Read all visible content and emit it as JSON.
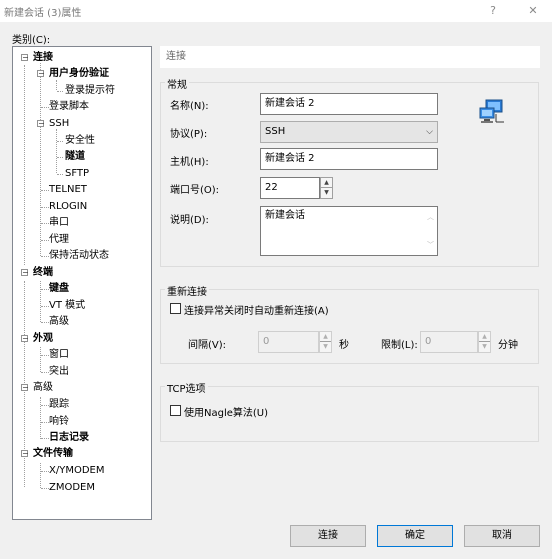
{
  "window": {
    "title": "新建会话 (3)属性",
    "help": "?",
    "close": "✕"
  },
  "category_label": "类别(C):",
  "tree": {
    "items": [
      {
        "label": "连接",
        "bold": true
      },
      {
        "label": "用户身份验证",
        "bold": true
      },
      {
        "label": "登录提示符"
      },
      {
        "label": "登录脚本"
      },
      {
        "label": "SSH"
      },
      {
        "label": "安全性"
      },
      {
        "label": "隧道",
        "bold": true
      },
      {
        "label": "SFTP"
      },
      {
        "label": "TELNET"
      },
      {
        "label": "RLOGIN"
      },
      {
        "label": "串口"
      },
      {
        "label": "代理"
      },
      {
        "label": "保持活动状态"
      },
      {
        "label": "终端",
        "bold": true
      },
      {
        "label": "键盘",
        "bold": true
      },
      {
        "label": "VT 模式"
      },
      {
        "label": "高级"
      },
      {
        "label": "外观",
        "bold": true
      },
      {
        "label": "窗口"
      },
      {
        "label": "突出"
      },
      {
        "label": "高级"
      },
      {
        "label": "跟踪"
      },
      {
        "label": "响铃"
      },
      {
        "label": "日志记录",
        "bold": true
      },
      {
        "label": "文件传输",
        "bold": true
      },
      {
        "label": "X/YMODEM"
      },
      {
        "label": "ZMODEM"
      }
    ]
  },
  "panel": {
    "header": "连接",
    "general": {
      "title": "常规",
      "name_label": "名称(N):",
      "name_value": "新建会话 2",
      "protocol_label": "协议(P):",
      "protocol_value": "SSH",
      "host_label": "主机(H):",
      "host_value": "新建会话 2",
      "port_label": "端口号(O):",
      "port_value": "22",
      "desc_label": "说明(D):",
      "desc_value": "新建会话"
    },
    "reconnect": {
      "title": "重新连接",
      "checkbox_label": "连接异常关闭时自动重新连接(A)",
      "interval_label": "间隔(V):",
      "interval_value": "0",
      "interval_unit": "秒",
      "limit_label": "限制(L):",
      "limit_value": "0",
      "limit_unit": "分钟"
    },
    "tcp": {
      "title": "TCP选项",
      "checkbox_label": "使用Nagle算法(U)"
    }
  },
  "buttons": {
    "connect": "连接",
    "ok": "确定",
    "cancel": "取消"
  },
  "colors": {
    "default_button_border": "#0078d7",
    "tree_border": "#828790"
  }
}
